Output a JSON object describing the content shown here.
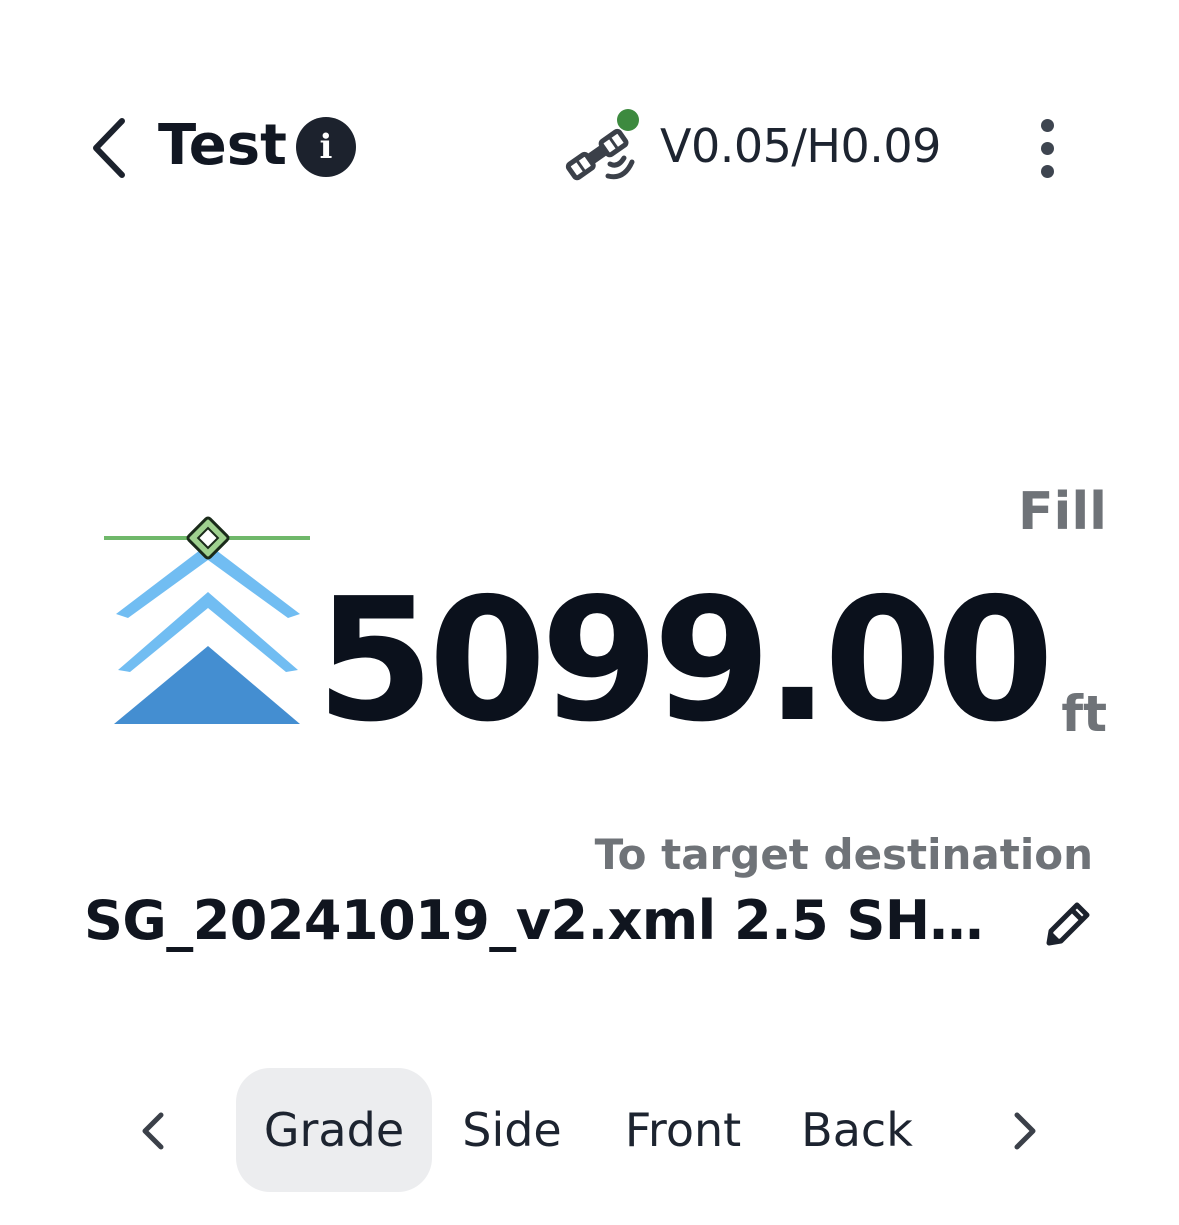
{
  "header": {
    "title": "Test",
    "info_icon": "info-icon",
    "back_icon": "chevron-left-icon",
    "gps": {
      "icon": "satellite-icon",
      "status_color": "#3d8a3f",
      "accuracy": "V0.05/H0.09"
    },
    "more_icon": "more-vertical-icon"
  },
  "reading": {
    "direction_label": "Fill",
    "value": "5099.00",
    "unit": "ft",
    "indicator_colors": {
      "line": "#6fb86a",
      "chevron_light": "#71bdf2",
      "chevron_dark": "#448ed1"
    }
  },
  "target": {
    "label": "To target destination",
    "name": "SG_20241019_v2.xml 2.5 SH1...",
    "edit_icon": "pencil-icon"
  },
  "tabs": {
    "items": [
      {
        "label": "Grade",
        "active": true
      },
      {
        "label": "Side",
        "active": false
      },
      {
        "label": "Front",
        "active": false
      },
      {
        "label": "Back",
        "active": false
      }
    ],
    "prev_icon": "chevron-left-icon",
    "next_icon": "chevron-right-icon"
  }
}
